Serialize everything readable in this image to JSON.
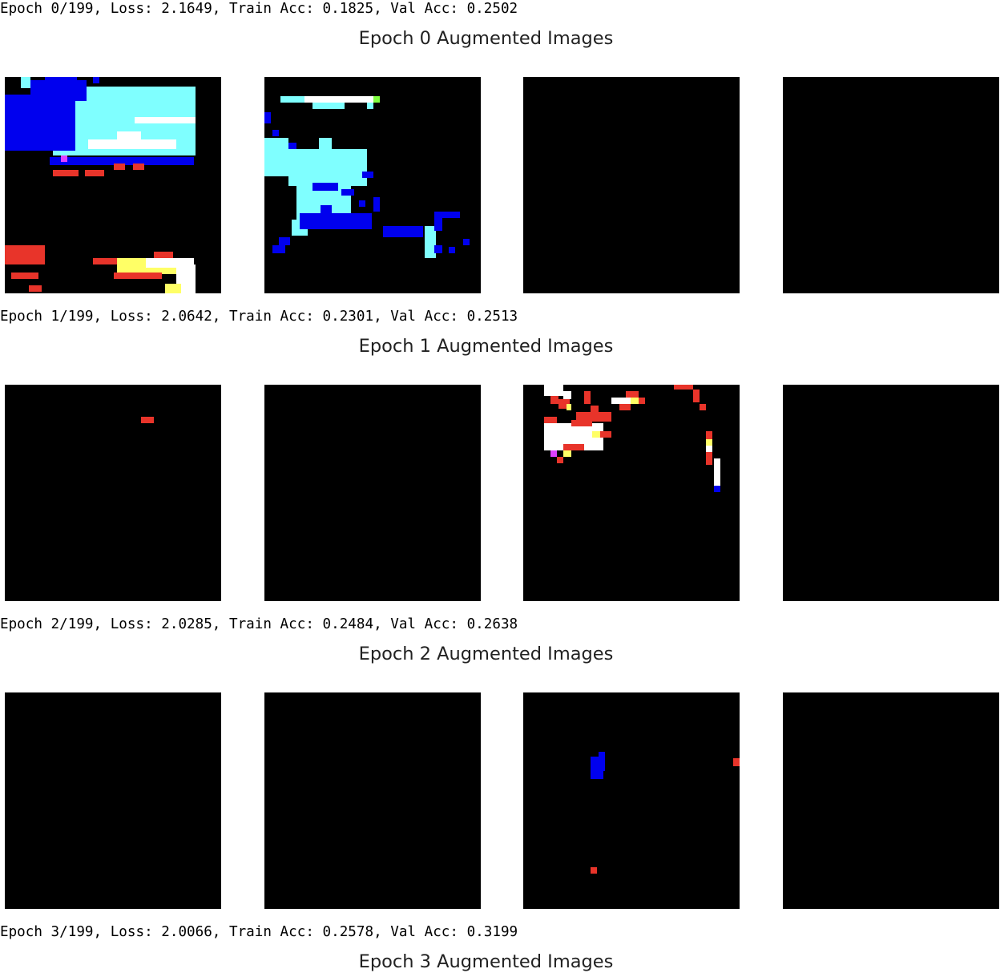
{
  "logs": [
    "Epoch 0/199, Loss: 2.1649, Train Acc: 0.1825, Val Acc: 0.2502",
    "Epoch 1/199, Loss: 2.0642, Train Acc: 0.2301, Val Acc: 0.2513",
    "Epoch 2/199, Loss: 2.0285, Train Acc: 0.2484, Val Acc: 0.2638",
    "Epoch 3/199, Loss: 2.0066, Train Acc: 0.2578, Val Acc: 0.3199"
  ],
  "figures": [
    {
      "title": "Epoch 0 Augmented Images",
      "images": [
        "augmented image",
        "augmented image",
        "augmented image",
        "augmented image"
      ]
    },
    {
      "title": "Epoch 1 Augmented Images",
      "images": [
        "augmented image",
        "augmented image",
        "augmented image",
        "augmented image"
      ]
    },
    {
      "title": "Epoch 2 Augmented Images",
      "images": [
        "augmented image",
        "augmented image",
        "augmented image",
        "augmented image"
      ]
    },
    {
      "title": "Epoch 3 Augmented Images",
      "images": []
    }
  ],
  "colors": {
    "background": "#000000",
    "blue": "#0000ee",
    "cyan": "#7fffff",
    "white": "#ffffff",
    "red": "#e8342a",
    "yellow": "#ffff66",
    "magenta": "#e040ff",
    "green": "#80ff40"
  }
}
